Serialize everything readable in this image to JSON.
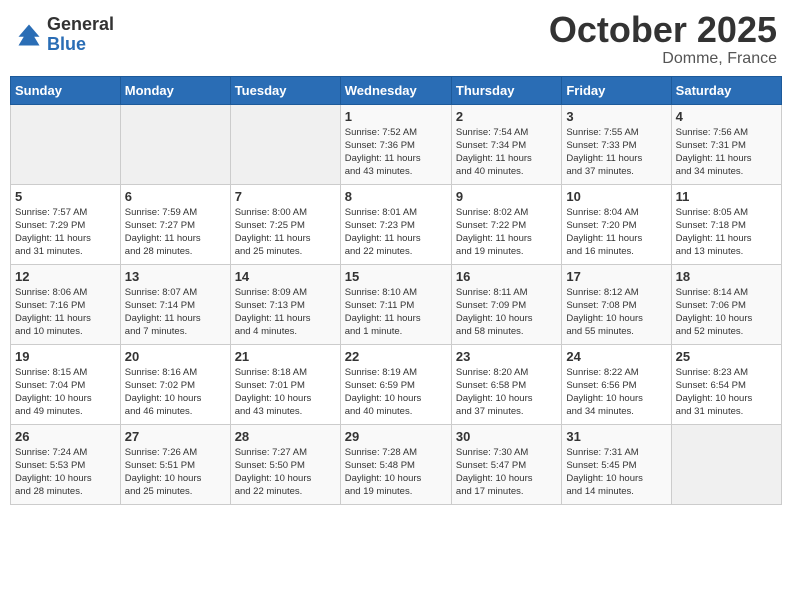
{
  "header": {
    "logo_general": "General",
    "logo_blue": "Blue",
    "month_title": "October 2025",
    "location": "Domme, France"
  },
  "days_of_week": [
    "Sunday",
    "Monday",
    "Tuesday",
    "Wednesday",
    "Thursday",
    "Friday",
    "Saturday"
  ],
  "weeks": [
    [
      {
        "day": "",
        "info": ""
      },
      {
        "day": "",
        "info": ""
      },
      {
        "day": "",
        "info": ""
      },
      {
        "day": "1",
        "info": "Sunrise: 7:52 AM\nSunset: 7:36 PM\nDaylight: 11 hours\nand 43 minutes."
      },
      {
        "day": "2",
        "info": "Sunrise: 7:54 AM\nSunset: 7:34 PM\nDaylight: 11 hours\nand 40 minutes."
      },
      {
        "day": "3",
        "info": "Sunrise: 7:55 AM\nSunset: 7:33 PM\nDaylight: 11 hours\nand 37 minutes."
      },
      {
        "day": "4",
        "info": "Sunrise: 7:56 AM\nSunset: 7:31 PM\nDaylight: 11 hours\nand 34 minutes."
      }
    ],
    [
      {
        "day": "5",
        "info": "Sunrise: 7:57 AM\nSunset: 7:29 PM\nDaylight: 11 hours\nand 31 minutes."
      },
      {
        "day": "6",
        "info": "Sunrise: 7:59 AM\nSunset: 7:27 PM\nDaylight: 11 hours\nand 28 minutes."
      },
      {
        "day": "7",
        "info": "Sunrise: 8:00 AM\nSunset: 7:25 PM\nDaylight: 11 hours\nand 25 minutes."
      },
      {
        "day": "8",
        "info": "Sunrise: 8:01 AM\nSunset: 7:23 PM\nDaylight: 11 hours\nand 22 minutes."
      },
      {
        "day": "9",
        "info": "Sunrise: 8:02 AM\nSunset: 7:22 PM\nDaylight: 11 hours\nand 19 minutes."
      },
      {
        "day": "10",
        "info": "Sunrise: 8:04 AM\nSunset: 7:20 PM\nDaylight: 11 hours\nand 16 minutes."
      },
      {
        "day": "11",
        "info": "Sunrise: 8:05 AM\nSunset: 7:18 PM\nDaylight: 11 hours\nand 13 minutes."
      }
    ],
    [
      {
        "day": "12",
        "info": "Sunrise: 8:06 AM\nSunset: 7:16 PM\nDaylight: 11 hours\nand 10 minutes."
      },
      {
        "day": "13",
        "info": "Sunrise: 8:07 AM\nSunset: 7:14 PM\nDaylight: 11 hours\nand 7 minutes."
      },
      {
        "day": "14",
        "info": "Sunrise: 8:09 AM\nSunset: 7:13 PM\nDaylight: 11 hours\nand 4 minutes."
      },
      {
        "day": "15",
        "info": "Sunrise: 8:10 AM\nSunset: 7:11 PM\nDaylight: 11 hours\nand 1 minute."
      },
      {
        "day": "16",
        "info": "Sunrise: 8:11 AM\nSunset: 7:09 PM\nDaylight: 10 hours\nand 58 minutes."
      },
      {
        "day": "17",
        "info": "Sunrise: 8:12 AM\nSunset: 7:08 PM\nDaylight: 10 hours\nand 55 minutes."
      },
      {
        "day": "18",
        "info": "Sunrise: 8:14 AM\nSunset: 7:06 PM\nDaylight: 10 hours\nand 52 minutes."
      }
    ],
    [
      {
        "day": "19",
        "info": "Sunrise: 8:15 AM\nSunset: 7:04 PM\nDaylight: 10 hours\nand 49 minutes."
      },
      {
        "day": "20",
        "info": "Sunrise: 8:16 AM\nSunset: 7:02 PM\nDaylight: 10 hours\nand 46 minutes."
      },
      {
        "day": "21",
        "info": "Sunrise: 8:18 AM\nSunset: 7:01 PM\nDaylight: 10 hours\nand 43 minutes."
      },
      {
        "day": "22",
        "info": "Sunrise: 8:19 AM\nSunset: 6:59 PM\nDaylight: 10 hours\nand 40 minutes."
      },
      {
        "day": "23",
        "info": "Sunrise: 8:20 AM\nSunset: 6:58 PM\nDaylight: 10 hours\nand 37 minutes."
      },
      {
        "day": "24",
        "info": "Sunrise: 8:22 AM\nSunset: 6:56 PM\nDaylight: 10 hours\nand 34 minutes."
      },
      {
        "day": "25",
        "info": "Sunrise: 8:23 AM\nSunset: 6:54 PM\nDaylight: 10 hours\nand 31 minutes."
      }
    ],
    [
      {
        "day": "26",
        "info": "Sunrise: 7:24 AM\nSunset: 5:53 PM\nDaylight: 10 hours\nand 28 minutes."
      },
      {
        "day": "27",
        "info": "Sunrise: 7:26 AM\nSunset: 5:51 PM\nDaylight: 10 hours\nand 25 minutes."
      },
      {
        "day": "28",
        "info": "Sunrise: 7:27 AM\nSunset: 5:50 PM\nDaylight: 10 hours\nand 22 minutes."
      },
      {
        "day": "29",
        "info": "Sunrise: 7:28 AM\nSunset: 5:48 PM\nDaylight: 10 hours\nand 19 minutes."
      },
      {
        "day": "30",
        "info": "Sunrise: 7:30 AM\nSunset: 5:47 PM\nDaylight: 10 hours\nand 17 minutes."
      },
      {
        "day": "31",
        "info": "Sunrise: 7:31 AM\nSunset: 5:45 PM\nDaylight: 10 hours\nand 14 minutes."
      },
      {
        "day": "",
        "info": ""
      }
    ]
  ]
}
